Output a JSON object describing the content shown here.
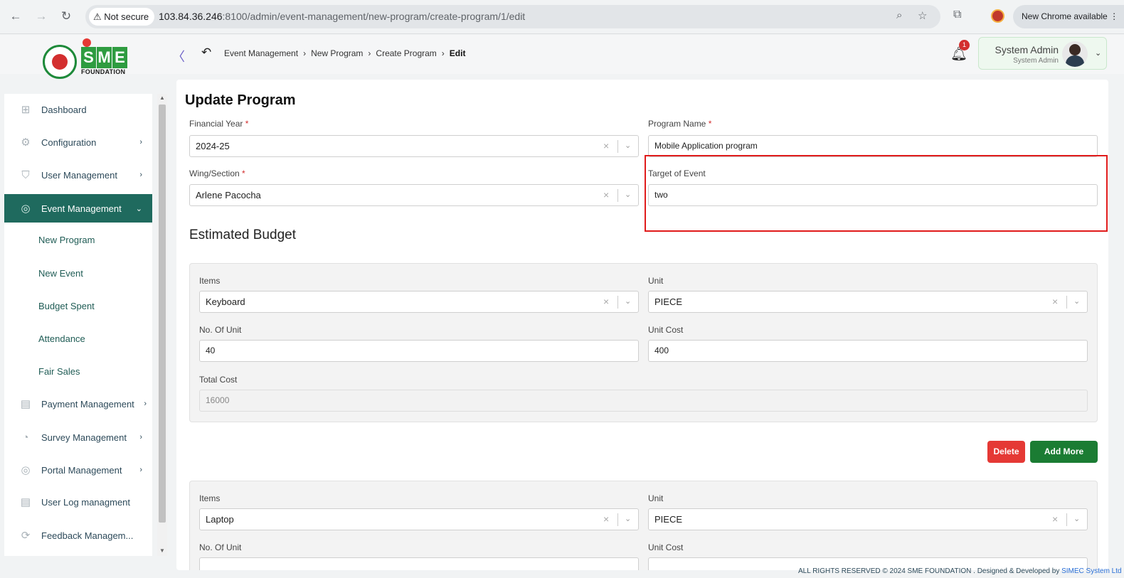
{
  "browser": {
    "security_label": "Not secure",
    "url_host": "103.84.36.246",
    "url_rest": ":8100/admin/event-management/new-program/create-program/1/edit",
    "update_label": "New Chrome available"
  },
  "header": {
    "logo_letters": [
      "S",
      "M",
      "E"
    ],
    "logo_subtitle": "FOUNDATION",
    "breadcrumb": [
      "Event Management",
      "New Program",
      "Create Program",
      "Edit"
    ],
    "notification_count": "1",
    "user_name": "System Admin",
    "user_role": "System Admin"
  },
  "sidebar": {
    "items": [
      {
        "label": "Dashboard",
        "icon": "grid-icon"
      },
      {
        "label": "Configuration",
        "icon": "config-icon"
      },
      {
        "label": "User Management",
        "icon": "shield-icon"
      },
      {
        "label": "Event Management",
        "icon": "event-icon"
      },
      {
        "label": "Payment Management",
        "icon": "payment-icon"
      },
      {
        "label": "Survey Management",
        "icon": "pie-icon"
      },
      {
        "label": "Portal Management",
        "icon": "portal-icon"
      },
      {
        "label": "User Log managment",
        "icon": "log-icon"
      },
      {
        "label": "Feedback Managem...",
        "icon": "feedback-icon"
      }
    ],
    "subitems": [
      "New Program",
      "New Event",
      "Budget Spent",
      "Attendance",
      "Fair Sales"
    ]
  },
  "form": {
    "title": "Update Program",
    "financial_year_label": "Financial Year",
    "financial_year_value": "2024-25",
    "program_name_label": "Program Name",
    "program_name_value": "Mobile Application program",
    "wing_label": "Wing/Section",
    "wing_value": "Arlene Pacocha",
    "target_label": "Target of Event",
    "target_value": "two",
    "required_mark": "*"
  },
  "budget": {
    "section_title": "Estimated Budget",
    "items_label": "Items",
    "unit_label": "Unit",
    "no_of_unit_label": "No. Of Unit",
    "unit_cost_label": "Unit Cost",
    "total_cost_label": "Total Cost",
    "entries": [
      {
        "item": "Keyboard",
        "unit": "PIECE",
        "no_of_unit": "40",
        "unit_cost": "400",
        "total_cost": "16000"
      },
      {
        "item": "Laptop",
        "unit": "PIECE"
      }
    ],
    "delete_label": "Delete",
    "add_more_label": "Add More"
  },
  "footer": {
    "text": "ALL RIGHTS RESERVED © 2024 SME FOUNDATION . Designed & Developed by",
    "link": "SIMEC System Ltd"
  },
  "colors": {
    "sidebar_active": "#1f6a5e",
    "add_button": "#1b7c33",
    "delete_button": "#e53935",
    "highlight": "#e01b1b"
  }
}
